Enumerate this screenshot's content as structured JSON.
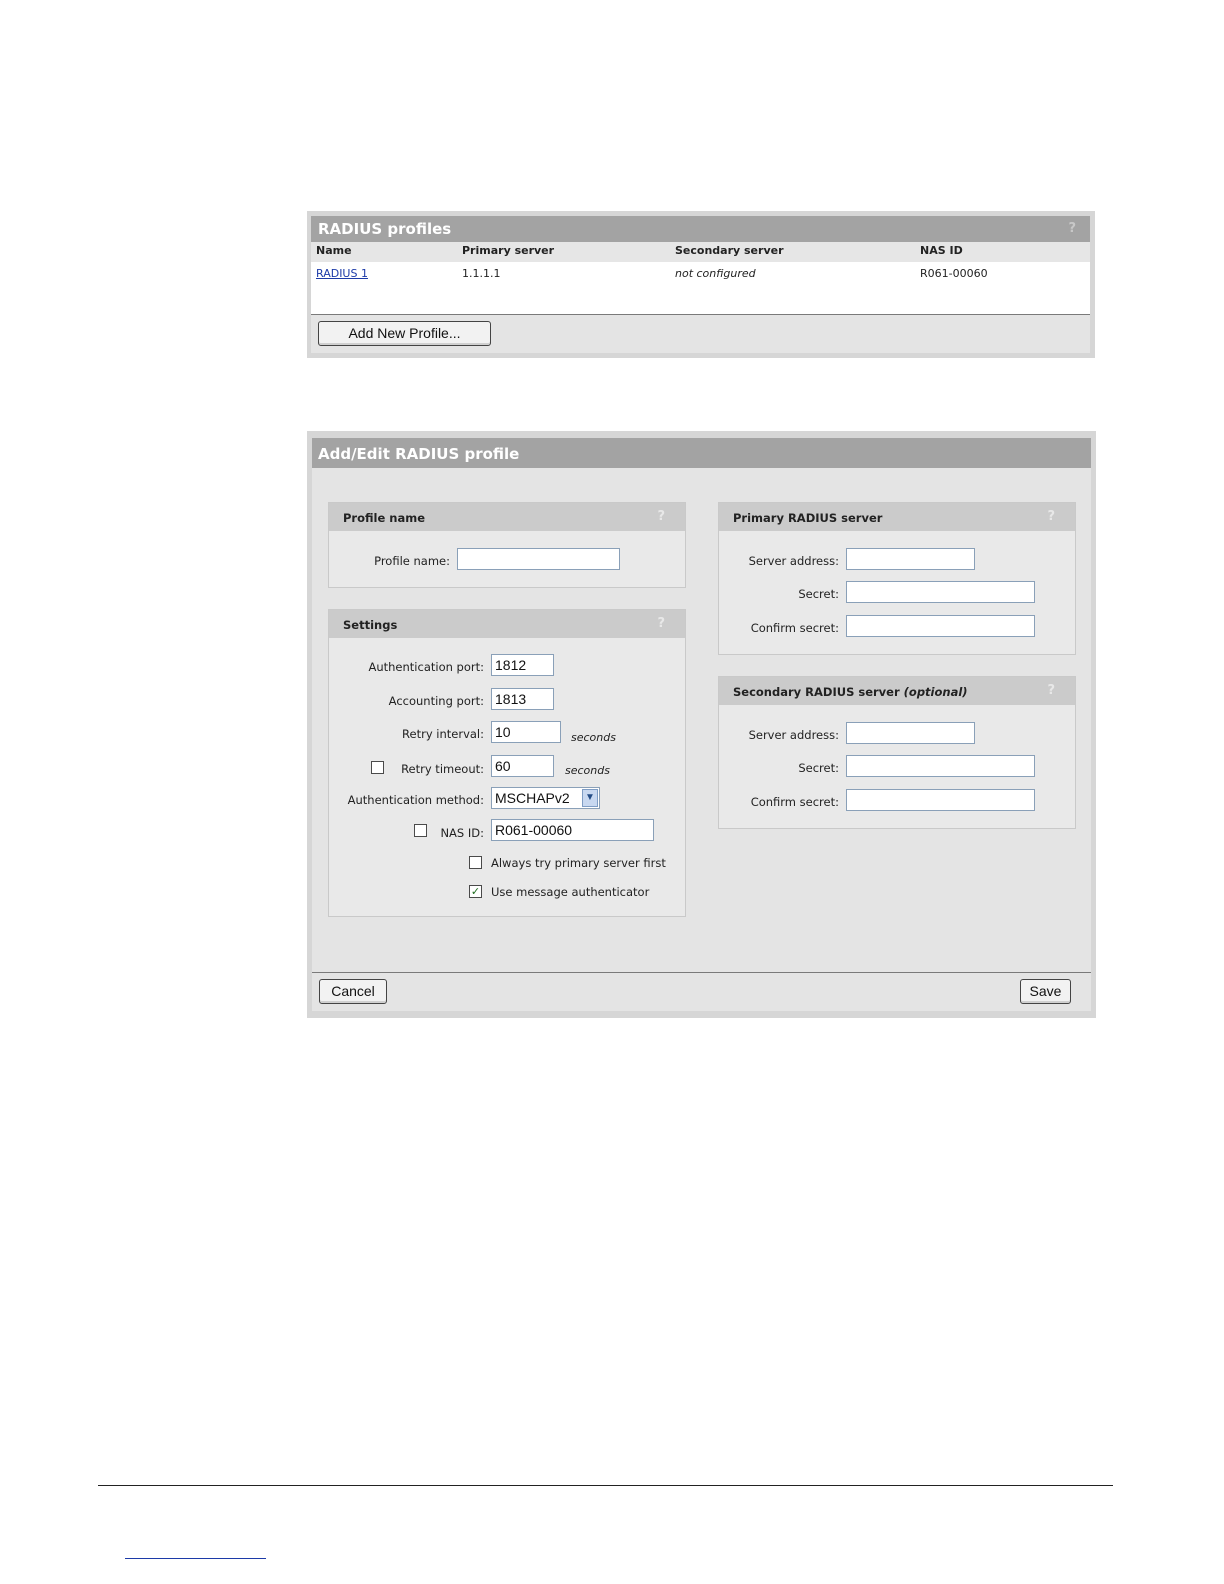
{
  "profiles_panel": {
    "title": "RADIUS profiles",
    "help": "?",
    "columns": [
      "Name",
      "Primary server",
      "Secondary server",
      "NAS ID"
    ],
    "rows": [
      {
        "name": "RADIUS 1",
        "primary": "1.1.1.1",
        "secondary": "not configured",
        "nas_id": "R061-00060"
      }
    ],
    "add_button": "Add New Profile..."
  },
  "edit_panel": {
    "title": "Add/Edit RADIUS profile",
    "profile_name": {
      "title": "Profile name",
      "help": "?",
      "label": "Profile name:",
      "value": ""
    },
    "settings": {
      "title": "Settings",
      "help": "?",
      "auth_port_label": "Authentication port:",
      "auth_port": "1812",
      "acct_port_label": "Accounting port:",
      "acct_port": "1813",
      "retry_interval_label": "Retry interval:",
      "retry_interval": "10",
      "retry_interval_unit": "seconds",
      "retry_timeout_label": "Retry timeout:",
      "retry_timeout": "60",
      "retry_timeout_unit": "seconds",
      "retry_timeout_checked": false,
      "auth_method_label": "Authentication method:",
      "auth_method": "MSCHAPv2",
      "nas_id_label": "NAS ID:",
      "nas_id": "R061-00060",
      "nas_id_checked": false,
      "always_primary_label": "Always try primary server first",
      "always_primary_checked": false,
      "msg_auth_label": "Use message authenticator",
      "msg_auth_checked": true
    },
    "primary": {
      "title": "Primary RADIUS server",
      "help": "?",
      "server_address_label": "Server address:",
      "secret_label": "Secret:",
      "confirm_label": "Confirm secret:"
    },
    "secondary": {
      "title": "Secondary RADIUS server",
      "title_suffix": "(optional)",
      "help": "?",
      "server_address_label": "Server address:",
      "secret_label": "Secret:",
      "confirm_label": "Confirm secret:"
    },
    "cancel_button": "Cancel",
    "save_button": "Save"
  }
}
